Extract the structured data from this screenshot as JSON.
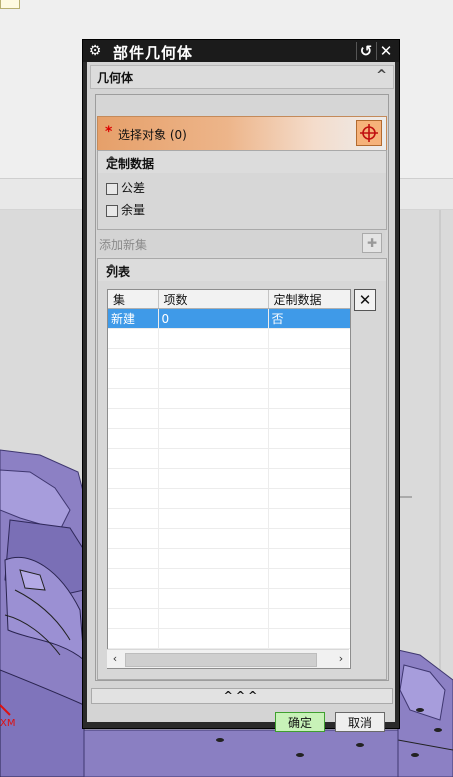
{
  "dialog": {
    "title": "部件几何体",
    "reset_icon": "reset-icon",
    "close_icon": "close-icon",
    "settings_icon": "gear-icon"
  },
  "geometry_section": {
    "title": "几何体",
    "select_object": {
      "required_mark": "*",
      "label": "选择对象 (0)"
    }
  },
  "custom_data": {
    "title": "定制数据",
    "options": [
      {
        "label": "公差",
        "checked": false
      },
      {
        "label": "余量",
        "checked": false
      }
    ]
  },
  "add_new_set": {
    "label": "添加新集"
  },
  "list": {
    "title": "列表",
    "columns": [
      "集",
      "项数",
      "定制数据"
    ],
    "rows": [
      {
        "set": "新建",
        "count": "0",
        "custom": "否",
        "selected": true
      }
    ]
  },
  "buttons": {
    "expand": "^^^",
    "ok": "确定",
    "cancel": "取消"
  },
  "viewport": {
    "axis_label": "XM"
  },
  "colors": {
    "select_accent": "#f6b27a",
    "selected_row": "#3f9ae8",
    "ok_button": "#c8f2b8",
    "model_purple": "#8c80c4"
  }
}
